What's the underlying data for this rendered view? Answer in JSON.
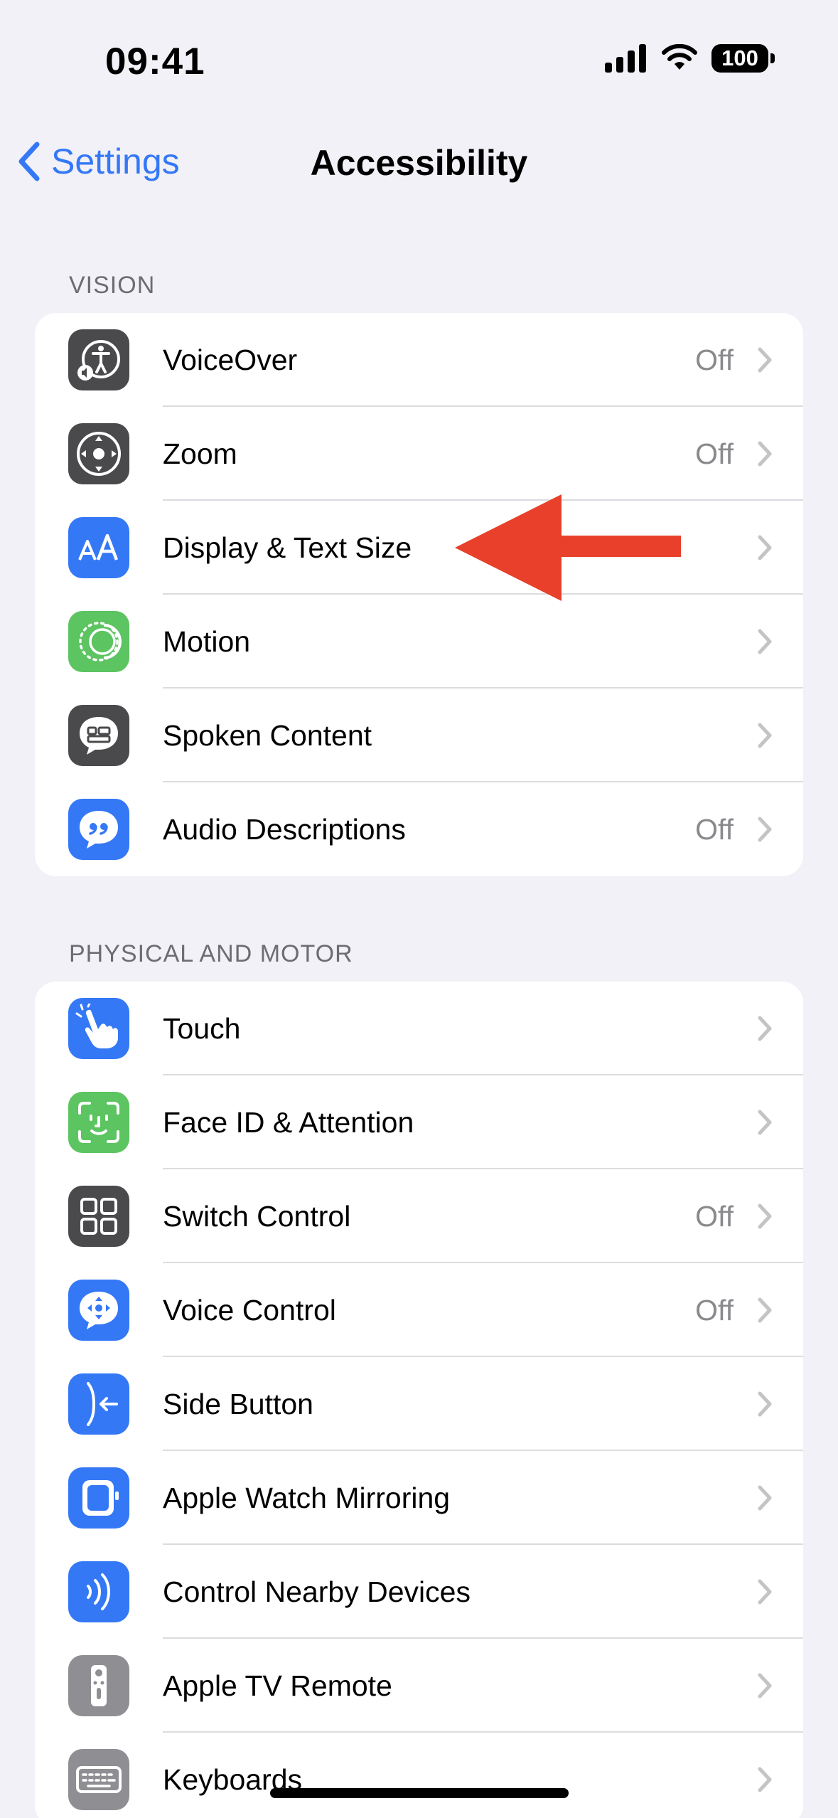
{
  "status_bar": {
    "time": "09:41",
    "battery": "100"
  },
  "nav": {
    "back_label": "Settings",
    "title": "Accessibility"
  },
  "sections": [
    {
      "header": "VISION",
      "items": [
        {
          "label": "VoiceOver",
          "value": "Off",
          "icon": "voiceover-icon",
          "icon_color": "#4a4a4c"
        },
        {
          "label": "Zoom",
          "value": "Off",
          "icon": "zoom-icon",
          "icon_color": "#4a4a4c"
        },
        {
          "label": "Display & Text Size",
          "value": "",
          "icon": "text-size-icon",
          "icon_color": "#3478f6"
        },
        {
          "label": "Motion",
          "value": "",
          "icon": "motion-icon",
          "icon_color": "#5cc461"
        },
        {
          "label": "Spoken Content",
          "value": "",
          "icon": "spoken-content-icon",
          "icon_color": "#4a4a4c"
        },
        {
          "label": "Audio Descriptions",
          "value": "Off",
          "icon": "audio-descriptions-icon",
          "icon_color": "#3478f6"
        }
      ]
    },
    {
      "header": "PHYSICAL AND MOTOR",
      "items": [
        {
          "label": "Touch",
          "value": "",
          "icon": "touch-icon",
          "icon_color": "#3478f6"
        },
        {
          "label": "Face ID & Attention",
          "value": "",
          "icon": "face-id-icon",
          "icon_color": "#5cc461"
        },
        {
          "label": "Switch Control",
          "value": "Off",
          "icon": "switch-control-icon",
          "icon_color": "#4a4a4c"
        },
        {
          "label": "Voice Control",
          "value": "Off",
          "icon": "voice-control-icon",
          "icon_color": "#3478f6"
        },
        {
          "label": "Side Button",
          "value": "",
          "icon": "side-button-icon",
          "icon_color": "#3478f6"
        },
        {
          "label": "Apple Watch Mirroring",
          "value": "",
          "icon": "apple-watch-icon",
          "icon_color": "#3478f6"
        },
        {
          "label": "Control Nearby Devices",
          "value": "",
          "icon": "nearby-devices-icon",
          "icon_color": "#3478f6"
        },
        {
          "label": "Apple TV Remote",
          "value": "",
          "icon": "tv-remote-icon",
          "icon_color": "#8e8e93"
        },
        {
          "label": "Keyboards",
          "value": "",
          "icon": "keyboard-icon",
          "icon_color": "#8e8e93"
        }
      ]
    }
  ],
  "colors": {
    "accent": "#3478f6",
    "annotation_arrow": "#e8402a"
  }
}
